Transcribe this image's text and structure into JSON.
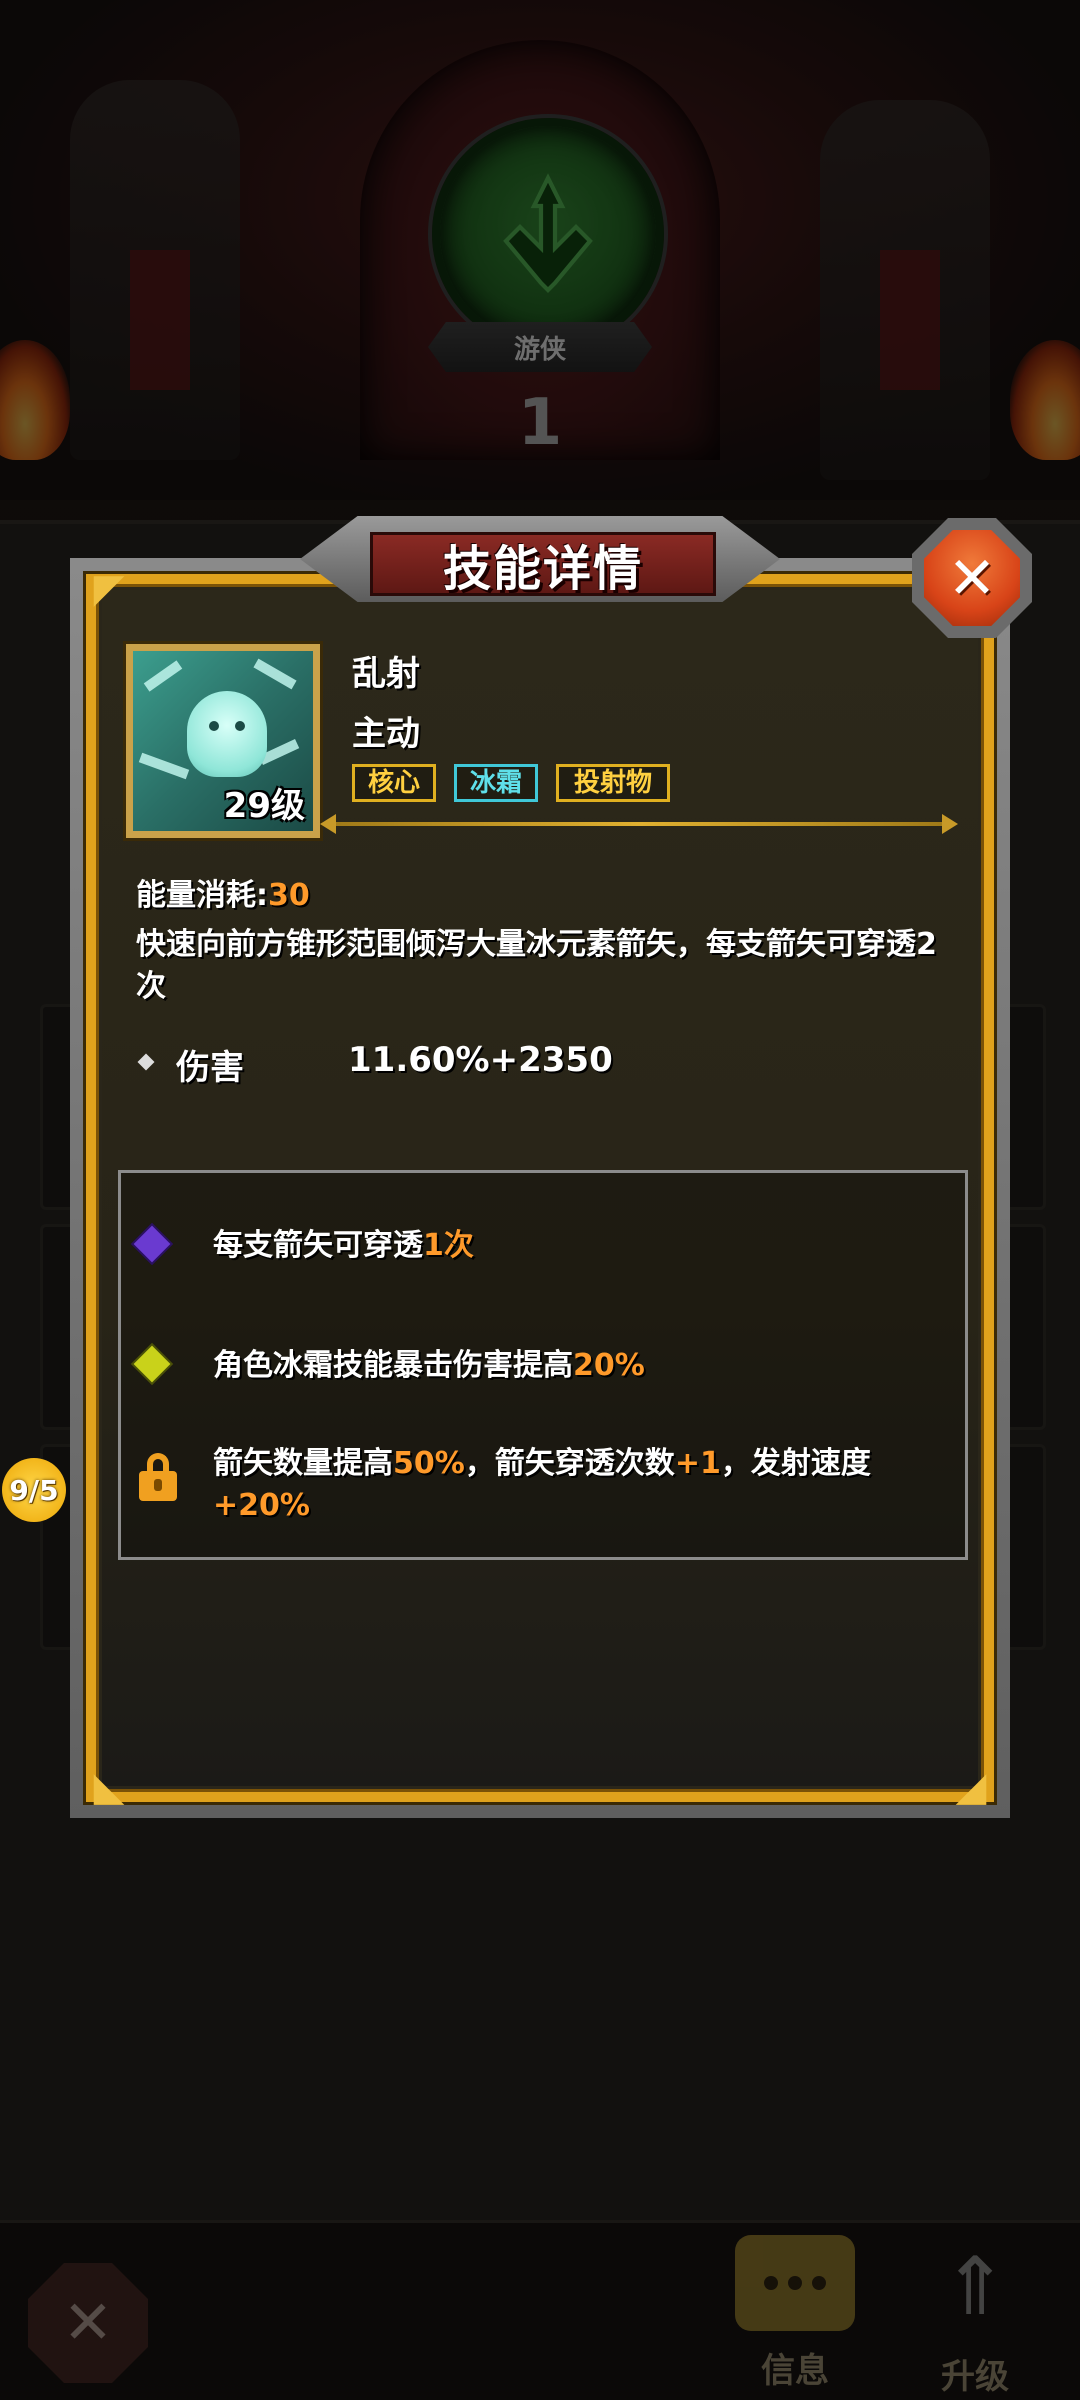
{
  "background": {
    "class_name": "游侠",
    "class_level": "1",
    "side_badge": "9/5"
  },
  "bottom_bar": {
    "info_label": "信息",
    "upgrade_label": "升级"
  },
  "modal": {
    "title": "技能详情",
    "close_icon": "close-x-icon"
  },
  "skill": {
    "name": "乱射",
    "type": "主动",
    "level_label": "29级",
    "tags": [
      "核心",
      "冰霜",
      "投射物"
    ],
    "energy_label": "能量消耗:",
    "energy_value": "30",
    "description": "快速向前方锥形范围倾泻大量冰元素箭矢，每支箭矢可穿透2次",
    "stat": {
      "name": "伤害",
      "value": "11.60%+2350"
    }
  },
  "upgrades": [
    {
      "gem": "purple",
      "text_a": "每支箭矢可穿透",
      "hl_a": "1次",
      "text_b": "",
      "hl_b": "",
      "text_c": "",
      "hl_c": ""
    },
    {
      "gem": "yellow",
      "text_a": "角色冰霜技能暴击伤害提高",
      "hl_a": "20%",
      "text_b": "",
      "hl_b": "",
      "text_c": "",
      "hl_c": ""
    },
    {
      "gem": "locked",
      "text_a": "箭矢数量提高",
      "hl_a": "50%",
      "text_b": "，箭矢穿透次数",
      "hl_b": "+1",
      "text_c": "，发射速度",
      "hl_c": "+20%"
    }
  ],
  "colors": {
    "gold_frame": "#e0a21c",
    "highlight": "#ff9a2a",
    "frost_tag": "#5fe0ea",
    "title_plate": "#8a2a24"
  }
}
